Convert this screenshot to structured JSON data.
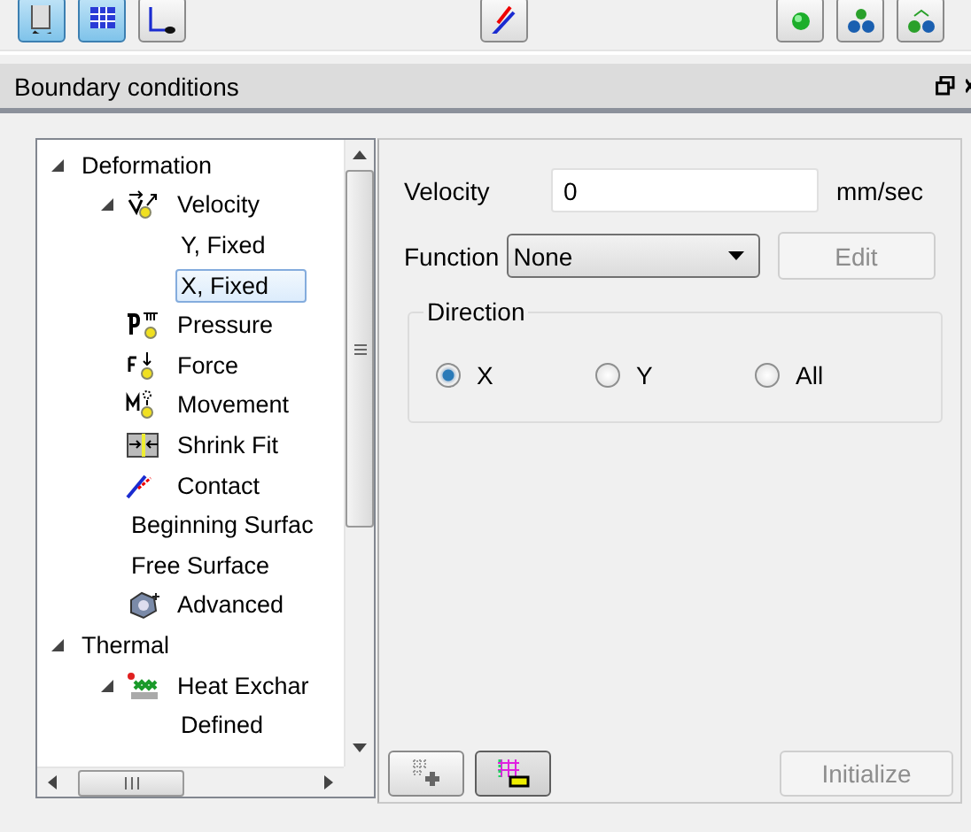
{
  "toolbar": [
    {
      "kind": "monitor",
      "selected": true
    },
    {
      "kind": "grid",
      "selected": true
    },
    {
      "kind": "screen",
      "selected": false
    },
    {
      "kind": "contact",
      "selected": false
    },
    {
      "kind": "sphere",
      "selected": false
    },
    {
      "kind": "spheres",
      "selected": false
    },
    {
      "kind": "linked",
      "selected": false
    }
  ],
  "panel": {
    "title": "Boundary conditions"
  },
  "tree": [
    {
      "label": "Deformation",
      "expanded": true,
      "selected": false,
      "children": [
        {
          "label": "Velocity",
          "kind": "velocity",
          "expanded": true,
          "selected": false,
          "children": [
            {
              "label": "Y, Fixed",
              "selected": false
            },
            {
              "label": "X, Fixed",
              "selected": true
            }
          ]
        },
        {
          "label": "Pressure",
          "kind": "pressure",
          "selected": false
        },
        {
          "label": "Force",
          "kind": "force",
          "selected": false
        },
        {
          "label": "Movement",
          "kind": "movement",
          "selected": false
        },
        {
          "label": "Shrink Fit",
          "kind": "shrink",
          "selected": false
        },
        {
          "label": "Contact",
          "kind": "contact",
          "selected": false
        },
        {
          "label": "Beginning Surfac",
          "selected": false
        },
        {
          "label": "Free Surface",
          "selected": false
        },
        {
          "label": "Advanced",
          "kind": "advanced",
          "selected": false
        }
      ]
    },
    {
      "label": "Thermal",
      "expanded": true,
      "selected": false,
      "children": [
        {
          "label": "Heat Exchar",
          "kind": "heat",
          "expanded": true,
          "selected": false,
          "children": [
            {
              "label": "Defined",
              "selected": false
            }
          ]
        }
      ]
    }
  ],
  "form": {
    "velocity": {
      "label": "Velocity",
      "value": "0",
      "unit": "mm/sec"
    },
    "function": {
      "label": "Function",
      "value": "None"
    },
    "edit_button": {
      "label": "Edit",
      "disabled": true
    },
    "direction": {
      "title": "Direction",
      "options": [
        {
          "label": "X",
          "selected": true
        },
        {
          "label": "Y",
          "selected": false
        },
        {
          "label": "All",
          "selected": false
        }
      ]
    },
    "mesh_buttons": [
      {
        "kind": "add",
        "pressed": false
      },
      {
        "kind": "remove",
        "pressed": true
      }
    ],
    "initialize_button": {
      "label": "Initialize",
      "disabled": true
    }
  }
}
